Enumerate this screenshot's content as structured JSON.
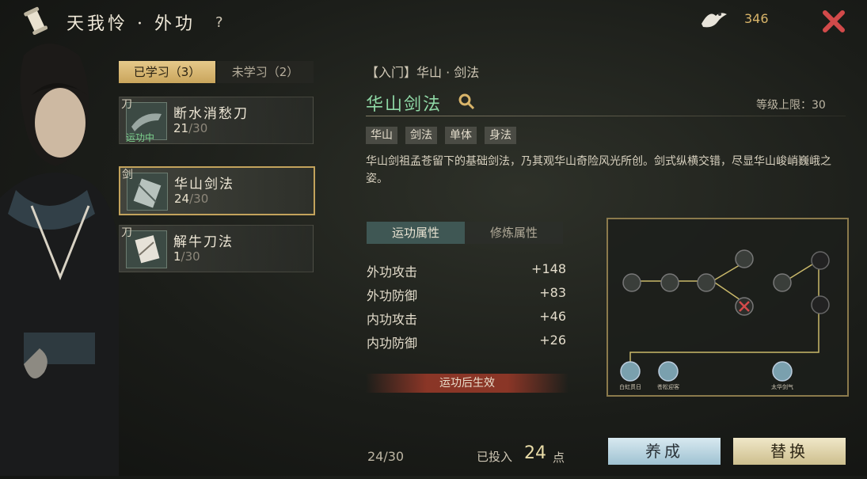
{
  "header": {
    "title": "天我怜 · 外功",
    "help": "?",
    "currency": "346"
  },
  "tabs": {
    "learned": "已学习（3）",
    "unlearned": "未学习（2）"
  },
  "skills": [
    {
      "tag": "刀",
      "name": "断水消愁刀",
      "level": "21",
      "max": "/30",
      "status": "运功中"
    },
    {
      "tag": "剑",
      "name": "华山剑法",
      "level": "24",
      "max": "/30",
      "status": ""
    },
    {
      "tag": "刀",
      "name": "解牛刀法",
      "level": "1",
      "max": "/30",
      "status": ""
    }
  ],
  "detail": {
    "breadcrumb": "【入门】华山 · 剑法",
    "title": "华山剑法",
    "level_cap": "等级上限：30",
    "chips": [
      "华山",
      "剑法",
      "单体",
      "身法"
    ],
    "description": "华山剑祖孟苍留下的基础剑法，乃其观华山奇险风光所创。剑式纵横交错，尽显华山峻峭巍峨之姿。"
  },
  "attributes": {
    "tab_active": "运功属性",
    "tab_train": "修炼属性",
    "stats": [
      {
        "label": "外功攻击",
        "value": "+148"
      },
      {
        "label": "外功防御",
        "value": "+83"
      },
      {
        "label": "内功攻击",
        "value": "+46"
      },
      {
        "label": "内功防御",
        "value": "+26"
      }
    ],
    "effect_note": "运功后生效"
  },
  "tree": {
    "bottom_labels": [
      "白虹贯日",
      "苍松迎客",
      "太华剑气"
    ]
  },
  "footer": {
    "points": "24/30",
    "invested_label": "已投入",
    "invested_value": "24",
    "invested_unit": "点",
    "cultivate": "养成",
    "replace": "替换"
  }
}
